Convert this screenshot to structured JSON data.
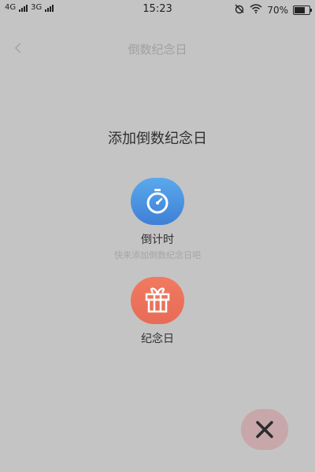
{
  "status_bar": {
    "network_1": "4G",
    "network_2": "3G",
    "time": "15:23",
    "battery": "70%",
    "battery_level": 0.7
  },
  "nav": {
    "back_glyph": "<",
    "title": "倒数纪念日"
  },
  "main": {
    "heading": "添加倒数纪念日",
    "options": [
      {
        "label": "倒计时",
        "sub": "快来添加倒数纪念日吧",
        "icon": "stopwatch-icon"
      },
      {
        "label": "纪念日",
        "icon": "gift-icon"
      }
    ]
  },
  "colors": {
    "overlay_bg": "#c4c4c4",
    "countdown_blue": "#4a90e2",
    "anniversary_orange": "#ee735a",
    "close_button_bg": "#c7a7aa"
  }
}
